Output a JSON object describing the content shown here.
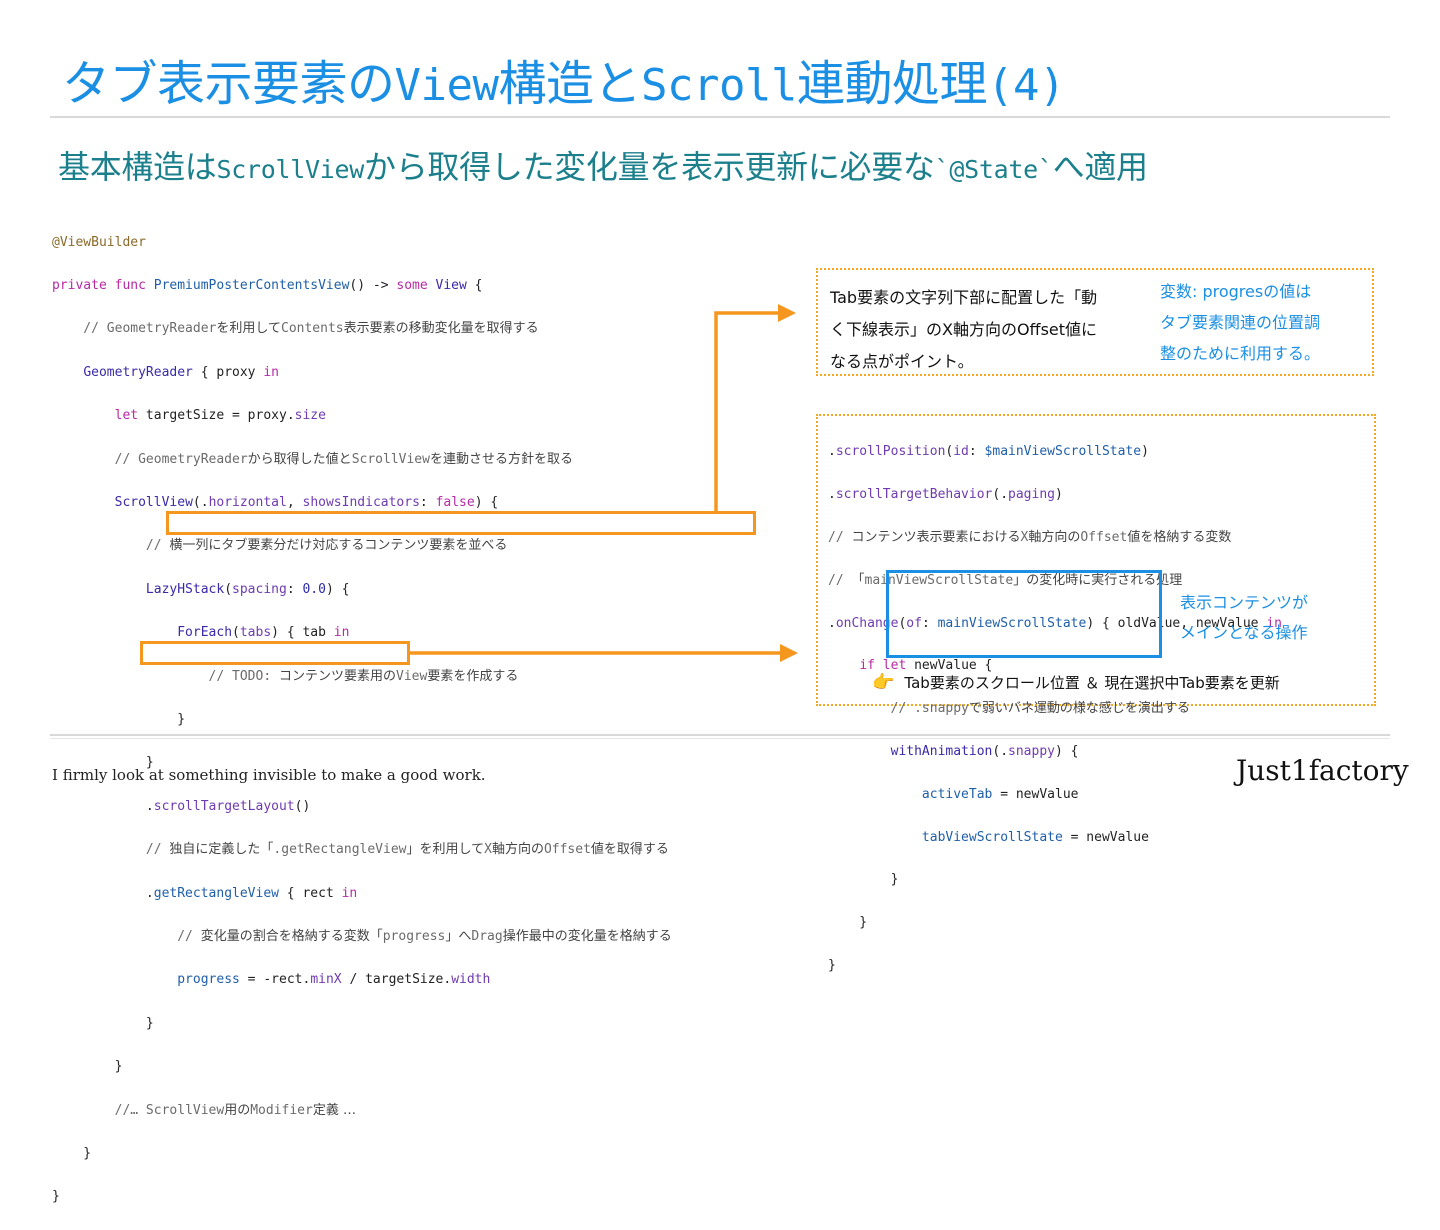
{
  "slide": {
    "title_pre": "タブ表示要素の",
    "title_view": "View",
    "title_mid": "構造と",
    "title_scroll": "Scroll",
    "title_post": "連動処理",
    "title_num": "(4)",
    "subtitle_pre": "基本構造は",
    "subtitle_mono1": "ScrollView",
    "subtitle_mid": "から取得した変化量を表示更新に必要な",
    "subtitle_mono2": "`@State`",
    "subtitle_post": "へ適用"
  },
  "code_left": {
    "l1": "@ViewBuilder",
    "l2a": "private func ",
    "l2b": "PremiumPosterContentsView",
    "l2c": "() -> ",
    "l2d": "some",
    "l2e": " ",
    "l2f": "View",
    "l2g": " {",
    "l3a": "    // GeometryReader",
    "l3b": "を利用して",
    "l3c": "Contents",
    "l3d": "表示要素の移動変化量を取得する",
    "l4a": "    ",
    "l4b": "GeometryReader",
    "l4c": " { proxy ",
    "l4d": "in",
    "l5a": "        ",
    "l5b": "let",
    "l5c": " targetSize = proxy.",
    "l5d": "size",
    "l6a": "        // GeometryReader",
    "l6b": "から取得した値と",
    "l6c": "ScrollView",
    "l6d": "を連動させる方針を取る",
    "l7a": "        ",
    "l7b": "ScrollView",
    "l7c": "(.",
    "l7d": "horizontal",
    "l7e": ", ",
    "l7f": "showsIndicators",
    "l7g": ": ",
    "l7h": "false",
    "l7i": ") {",
    "l8a": "            // ",
    "l8b": "横一列にタブ要素分だけ対応するコンテンツ要素を並べる",
    "l9a": "            ",
    "l9b": "LazyHStack",
    "l9c": "(",
    "l9d": "spacing",
    "l9e": ": ",
    "l9f": "0.0",
    "l9g": ") {",
    "l10a": "                ",
    "l10b": "ForEach",
    "l10c": "(",
    "l10d": "tabs",
    "l10e": ") { tab ",
    "l10f": "in",
    "l11a": "                    // TODO: ",
    "l11b": "コンテンツ要素用の",
    "l11c": "View",
    "l11d": "要素を作成する",
    "l12": "                }",
    "l13": "            }",
    "l14a": "            .",
    "l14b": "scrollTargetLayout",
    "l14c": "()",
    "l15a": "            // ",
    "l15b": "独自に定義した「",
    "l15c": ".getRectangleView",
    "l15d": "」を利用して",
    "l15e": "X",
    "l15f": "軸方向の",
    "l15g": "Offset",
    "l15h": "値を取得する",
    "l16a": "            .",
    "l16b": "getRectangleView",
    "l16c": " { rect ",
    "l16d": "in",
    "l17a": "                // ",
    "l17b": "変化量の割合を格納する変数「",
    "l17c": "progress",
    "l17d": "」へ",
    "l17e": "Drag",
    "l17f": "操作最中の変化量を格納する",
    "l18a": "                ",
    "l18b": "progress",
    "l18c": " = -rect.",
    "l18d": "minX",
    "l18e": " / targetSize.",
    "l18f": "width",
    "l19": "            }",
    "l20": "        }",
    "l21a": "        //",
    "l21b": "… ScrollView",
    "l21c": "用の",
    "l21d": "Modifier",
    "l21e": "定義 …",
    "l22": "    }",
    "l23": "}"
  },
  "note_main": {
    "p1": "Tab要素の文字列下部に配置した「動",
    "p2": "く下線表示」のX軸方向のOffset値に",
    "p3": "なる点がポイント。"
  },
  "note_side": {
    "p1": "変数: progresの値は",
    "p2": "タブ要素関連の位置調",
    "p3": "整のために利用する。"
  },
  "code_right": {
    "l1a": ".",
    "l1b": "scrollPosition",
    "l1c": "(",
    "l1d": "id",
    "l1e": ": ",
    "l1f": "$mainViewScrollState",
    "l1g": ")",
    "l2a": ".",
    "l2b": "scrollTargetBehavior",
    "l2c": "(.",
    "l2d": "paging",
    "l2e": ")",
    "l3a": "// ",
    "l3b": "コンテンツ表示要素における",
    "l3c": "X",
    "l3d": "軸方向の",
    "l3e": "Offset",
    "l3f": "値を格納する変数",
    "l4a": "// ",
    "l4b": "「",
    "l4c": "mainViewScrollState",
    "l4d": "」の変化時に実行される処理",
    "l5a": ".",
    "l5b": "onChange",
    "l5c": "(",
    "l5d": "of",
    "l5e": ": ",
    "l5f": "mainViewScrollState",
    "l5g": ") { oldValue, newValue ",
    "l5h": "in",
    "l6a": "    ",
    "l6b": "if",
    "l6c": " ",
    "l6d": "let",
    "l6e": " newValue {",
    "l7a": "        // .snappy",
    "l7b": "で弱いバネ運動の様な感じを演出する",
    "l8a": "        ",
    "l8b": "withAnimation",
    "l8c": "(.",
    "l8d": "snappy",
    "l8e": ") {",
    "l9a": "            ",
    "l9b": "activeTab",
    "l9c": " = newValue",
    "l10a": "            ",
    "l10b": "tabViewScrollState",
    "l10c": " = newValue",
    "l11": "        }",
    "l12": "    }",
    "l13": "}"
  },
  "blue_note": {
    "p1": "表示コンテンツが",
    "p2": "メインとなる操作"
  },
  "tab_note": {
    "hand": "👉",
    "text": "Tab要素のスクロール位置 ＆ 現在選択中Tab要素を更新"
  },
  "footer": {
    "left": "I firmly look at something invisible to make a good work.",
    "right": "Just1factory"
  },
  "colors": {
    "title": "#1a8fe3",
    "subtitle": "#1b7f8c",
    "highlight_orange": "#f5961e",
    "highlight_blue": "#1a8fe3"
  },
  "icons": {
    "hand": "pointing-hand-icon",
    "arrow": "arrow-right-icon"
  }
}
